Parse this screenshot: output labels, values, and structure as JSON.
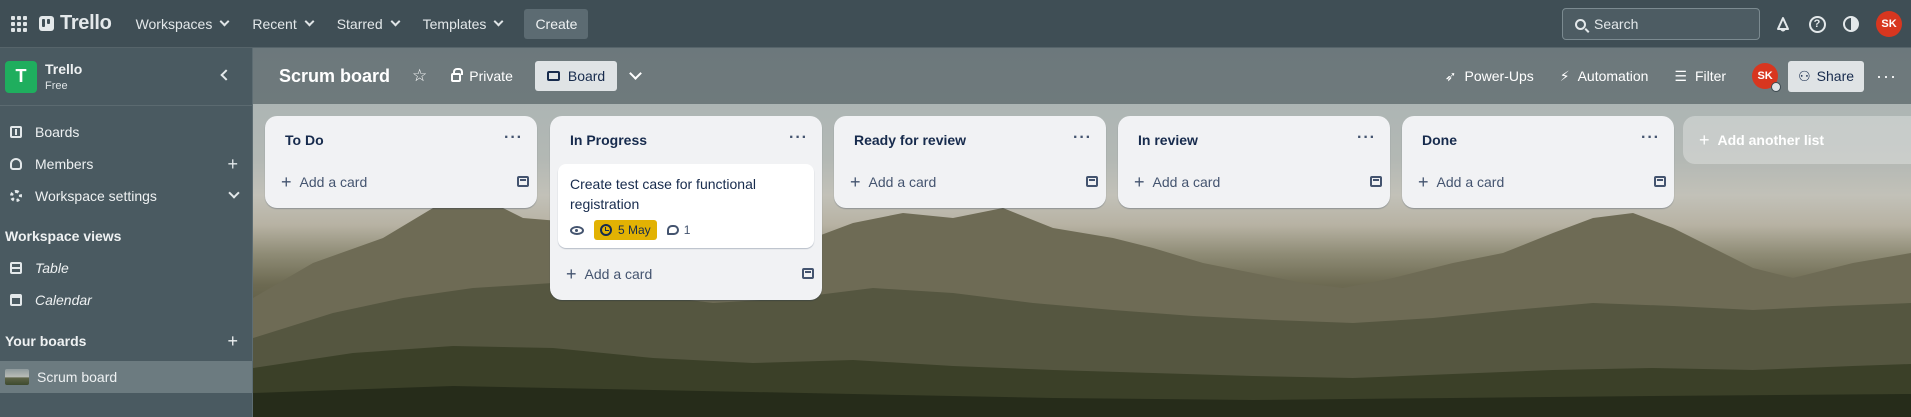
{
  "topbar": {
    "logo_text": "Trello",
    "nav": [
      "Workspaces",
      "Recent",
      "Starred",
      "Templates"
    ],
    "create_label": "Create",
    "search_placeholder": "Search",
    "avatar_initials": "SK"
  },
  "sidebar": {
    "workspace_initial": "T",
    "workspace_name": "Trello",
    "workspace_plan": "Free",
    "items": [
      {
        "label": "Boards"
      },
      {
        "label": "Members"
      },
      {
        "label": "Workspace settings"
      }
    ],
    "views_title": "Workspace views",
    "views": [
      {
        "label": "Table"
      },
      {
        "label": "Calendar"
      }
    ],
    "boards_title": "Your boards",
    "boards": [
      {
        "label": "Scrum board"
      }
    ]
  },
  "board": {
    "title": "Scrum board",
    "visibility": "Private",
    "view_label": "Board",
    "powerups_label": "Power-Ups",
    "automation_label": "Automation",
    "filter_label": "Filter",
    "avatar_initials": "SK",
    "share_label": "Share",
    "add_list_label": "Add another list",
    "add_card_label": "Add a card",
    "lists": [
      {
        "title": "To Do",
        "cards": []
      },
      {
        "title": "In Progress",
        "cards": [
          {
            "title": "Create test case for functional registration",
            "due": "5 May",
            "comments": "1"
          }
        ]
      },
      {
        "title": "Ready for review",
        "cards": []
      },
      {
        "title": "In review",
        "cards": []
      },
      {
        "title": "Done",
        "cards": []
      }
    ]
  },
  "colors": {
    "accent_green": "#1fae5e",
    "due_badge": "#e2b203",
    "avatar_red": "#d8361f"
  }
}
